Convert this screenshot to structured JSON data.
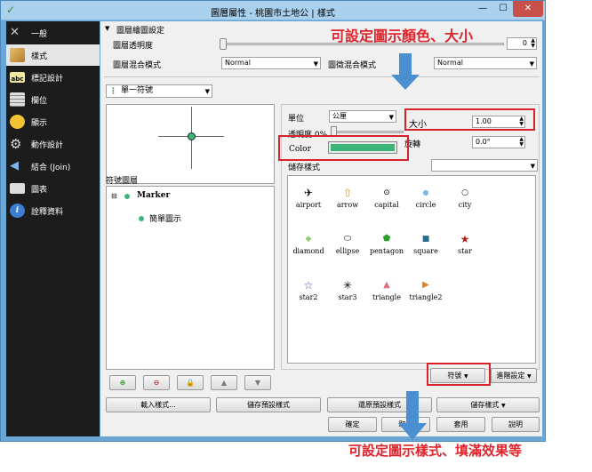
{
  "window": {
    "title": "圖層屬性 - 桃園市土地公 | 樣式",
    "minimize": "—",
    "maximize": "☐",
    "close": "✕"
  },
  "sidebar": {
    "items": [
      {
        "label": "一般",
        "icon": "wrench-icon"
      },
      {
        "label": "樣式",
        "icon": "brush-icon"
      },
      {
        "label": "標記設計",
        "icon": "abc-label-icon"
      },
      {
        "label": "欄位",
        "icon": "table-icon"
      },
      {
        "label": "顯示",
        "icon": "speech-bubble-icon"
      },
      {
        "label": "動作設計",
        "icon": "gear-icon"
      },
      {
        "label": "結合 (Join)",
        "icon": "join-icon"
      },
      {
        "label": "圖表",
        "icon": "chart-icon"
      },
      {
        "label": "詮釋資料",
        "icon": "info-icon"
      }
    ]
  },
  "render": {
    "section": "圖層繪圖設定",
    "transparency_label": "圖層透明度",
    "transparency_value": "0",
    "blend_label": "圖層混合模式",
    "blend_value": "Normal",
    "feature_blend_label": "圖徵混合模式",
    "feature_blend_value": "Normal"
  },
  "renderer": {
    "type": "單一符號"
  },
  "symbol_layers": {
    "title": "符號圖層",
    "root": "Marker",
    "child": "簡單圖示"
  },
  "props": {
    "unit_label": "單位",
    "unit_value": "公厘",
    "transparency_label": "透明度 0%",
    "size_label": "大小",
    "size_value": "1.00",
    "color_label": "Color",
    "color_swatch": "#3cb47a",
    "rotation_label": "旋轉",
    "rotation_value": "0.0°",
    "saved_styles_label": "儲存樣式"
  },
  "symbols": [
    {
      "name": "airport",
      "glyph": "✈"
    },
    {
      "name": "arrow",
      "glyph": "⇧"
    },
    {
      "name": "capital",
      "glyph": "⊙"
    },
    {
      "name": "circle",
      "glyph": "●"
    },
    {
      "name": "city",
      "glyph": "○"
    },
    {
      "name": "diamond",
      "glyph": "◆"
    },
    {
      "name": "ellipse",
      "glyph": "⬭"
    },
    {
      "name": "pentagon",
      "glyph": "⬟"
    },
    {
      "name": "square",
      "glyph": "■"
    },
    {
      "name": "star",
      "glyph": "★"
    },
    {
      "name": "star2",
      "glyph": "☆"
    },
    {
      "name": "star3",
      "glyph": "✳"
    },
    {
      "name": "triangle",
      "glyph": "▲"
    },
    {
      "name": "triangle2",
      "glyph": "▶"
    }
  ],
  "buttons": {
    "symbol": "符號",
    "advanced": "進階設定",
    "load_style": "載入樣式...",
    "save_default": "儲存預設樣式",
    "restore_default": "還原預設樣式",
    "save_style": "儲存樣式",
    "ok": "確定",
    "cancel": "取消",
    "apply": "套用",
    "help": "說明"
  },
  "annotations": {
    "top": "可設定圖示顏色、大小",
    "bottom": "可設定圖示樣式、填滿效果等"
  },
  "colors": {
    "accent": "#4a8fd0",
    "red": "#d8222a",
    "symbol_green": "#3cb47a"
  }
}
